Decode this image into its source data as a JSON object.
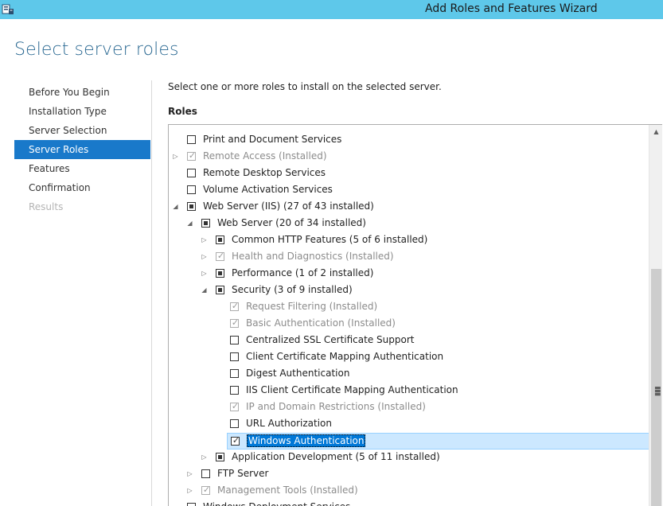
{
  "window": {
    "title": "Add Roles and Features Wizard"
  },
  "page": {
    "title": "Select server roles",
    "instruction": "Select one or more roles to install on the selected server.",
    "roles_label": "Roles"
  },
  "nav": {
    "items": [
      {
        "label": "Before You Begin",
        "state": "normal"
      },
      {
        "label": "Installation Type",
        "state": "normal"
      },
      {
        "label": "Server Selection",
        "state": "normal"
      },
      {
        "label": "Server Roles",
        "state": "active"
      },
      {
        "label": "Features",
        "state": "normal"
      },
      {
        "label": "Confirmation",
        "state": "normal"
      },
      {
        "label": "Results",
        "state": "disabled"
      }
    ]
  },
  "roles": [
    {
      "label": "Print and Document Services",
      "level": 0,
      "expander": "none",
      "check": "unchecked"
    },
    {
      "label": "Remote Access (Installed)",
      "level": 0,
      "expander": "collapsed",
      "check": "installed"
    },
    {
      "label": "Remote Desktop Services",
      "level": 0,
      "expander": "none",
      "check": "unchecked"
    },
    {
      "label": "Volume Activation Services",
      "level": 0,
      "expander": "none",
      "check": "unchecked"
    },
    {
      "label": "Web Server (IIS) (27 of 43 installed)",
      "level": 0,
      "expander": "expanded",
      "check": "partial"
    },
    {
      "label": "Web Server (20 of 34 installed)",
      "level": 1,
      "expander": "expanded",
      "check": "partial"
    },
    {
      "label": "Common HTTP Features (5 of 6 installed)",
      "level": 2,
      "expander": "collapsed",
      "check": "partial"
    },
    {
      "label": "Health and Diagnostics (Installed)",
      "level": 2,
      "expander": "collapsed",
      "check": "installed"
    },
    {
      "label": "Performance (1 of 2 installed)",
      "level": 2,
      "expander": "collapsed",
      "check": "partial"
    },
    {
      "label": "Security (3 of 9 installed)",
      "level": 2,
      "expander": "expanded",
      "check": "partial"
    },
    {
      "label": "Request Filtering (Installed)",
      "level": 3,
      "expander": "none",
      "check": "installed"
    },
    {
      "label": "Basic Authentication (Installed)",
      "level": 3,
      "expander": "none",
      "check": "installed"
    },
    {
      "label": "Centralized SSL Certificate Support",
      "level": 3,
      "expander": "none",
      "check": "unchecked"
    },
    {
      "label": "Client Certificate Mapping Authentication",
      "level": 3,
      "expander": "none",
      "check": "unchecked"
    },
    {
      "label": "Digest Authentication",
      "level": 3,
      "expander": "none",
      "check": "unchecked"
    },
    {
      "label": "IIS Client Certificate Mapping Authentication",
      "level": 3,
      "expander": "none",
      "check": "unchecked"
    },
    {
      "label": "IP and Domain Restrictions (Installed)",
      "level": 3,
      "expander": "none",
      "check": "installed"
    },
    {
      "label": "URL Authorization",
      "level": 3,
      "expander": "none",
      "check": "unchecked"
    },
    {
      "label": "Windows Authentication",
      "level": 3,
      "expander": "none",
      "check": "checked",
      "selected": true
    },
    {
      "label": "Application Development (5 of 11 installed)",
      "level": 2,
      "expander": "collapsed",
      "check": "partial"
    },
    {
      "label": "FTP Server",
      "level": 1,
      "expander": "collapsed",
      "check": "unchecked"
    },
    {
      "label": "Management Tools (Installed)",
      "level": 1,
      "expander": "collapsed",
      "check": "installed"
    },
    {
      "label": "Windows Deployment Services",
      "level": 0,
      "expander": "none",
      "check": "unchecked"
    }
  ],
  "colors": {
    "titlebar": "#5ec8ea",
    "accent": "#1979ca",
    "page_title": "#2c6a93",
    "selection": "#0078d7"
  },
  "icons": {
    "app": "server-manager-icon",
    "collapsed": "triangle-right",
    "expanded": "triangle-down-right",
    "scroll_up": "chevron-up"
  }
}
